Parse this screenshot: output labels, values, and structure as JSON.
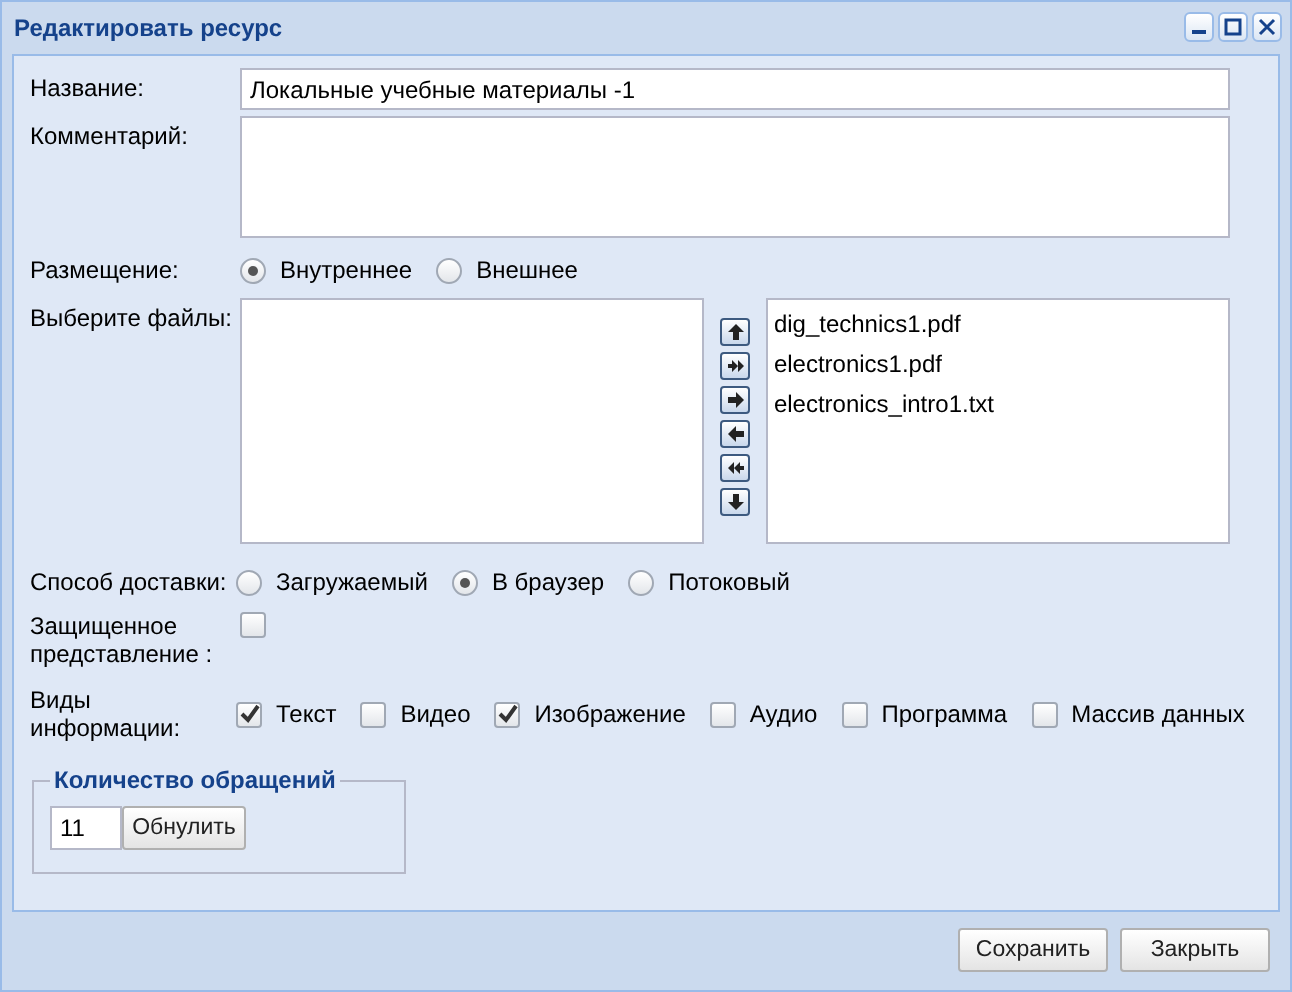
{
  "window": {
    "title": "Редактировать ресурс"
  },
  "fields": {
    "name_label": "Название:",
    "name_value": "Локальные учебные материалы -1",
    "comment_label": "Комментарий:"
  },
  "placement": {
    "label": "Размещение:",
    "options": [
      {
        "label": "Внутреннее",
        "selected": true
      },
      {
        "label": "Внешнее",
        "selected": false
      }
    ]
  },
  "files": {
    "label": "Выберите файлы:",
    "selected_files": [
      "dig_technics1.pdf",
      "electronics1.pdf",
      "electronics_intro1.txt"
    ],
    "move_buttons": [
      {
        "kind": "up"
      },
      {
        "kind": "all-right"
      },
      {
        "kind": "right"
      },
      {
        "kind": "left"
      },
      {
        "kind": "all-left"
      },
      {
        "kind": "down"
      }
    ]
  },
  "delivery": {
    "label": "Способ доставки:",
    "options": [
      {
        "label": "Загружаемый",
        "selected": false
      },
      {
        "label": "В браузер",
        "selected": true
      },
      {
        "label": "Потоковый",
        "selected": false
      }
    ]
  },
  "protected": {
    "label": "Защищенное представление :",
    "checked": false
  },
  "info_types": {
    "label": "Виды информации:",
    "options": [
      {
        "label": "Текст",
        "checked": true
      },
      {
        "label": "Видео",
        "checked": false
      },
      {
        "label": "Изображение",
        "checked": true
      },
      {
        "label": "Аудио",
        "checked": false
      },
      {
        "label": "Программа",
        "checked": false
      },
      {
        "label": "Массив данных",
        "checked": false
      }
    ]
  },
  "access_count": {
    "title": "Количество обращений",
    "value": "11",
    "reset_button": "Обнулить"
  },
  "buttons": [
    "Сохранить",
    "Закрыть"
  ]
}
